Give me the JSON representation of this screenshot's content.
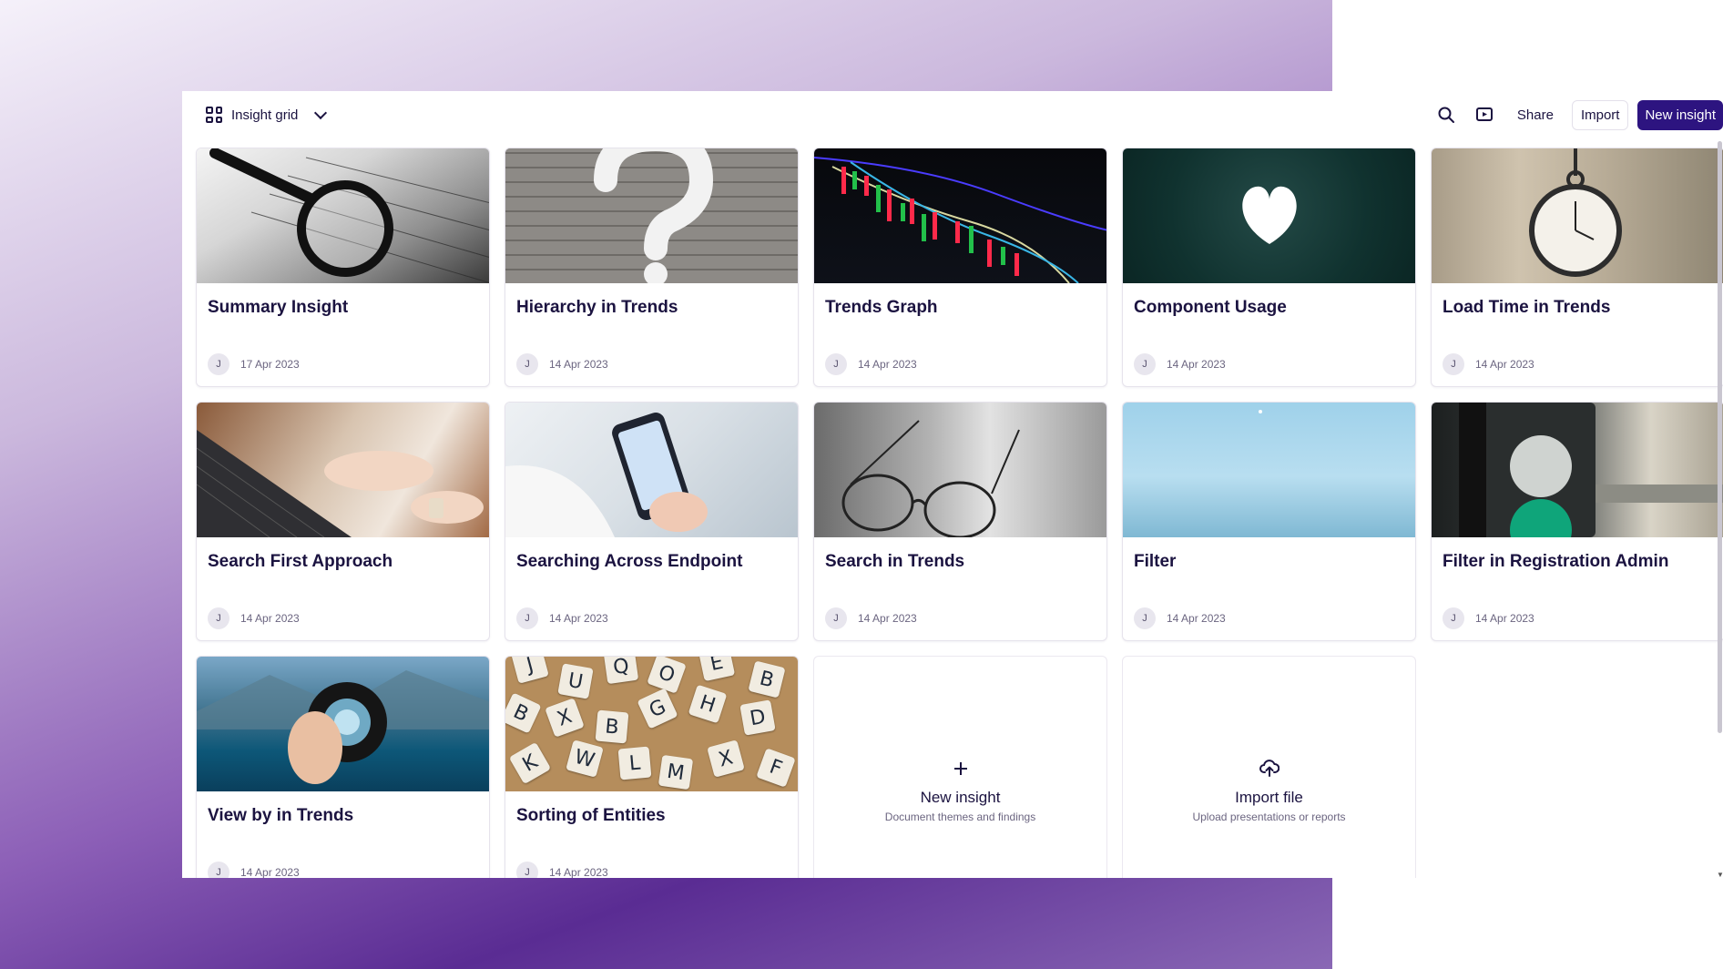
{
  "toolbar": {
    "view_label": "Insight grid",
    "share_label": "Share",
    "import_label": "Import",
    "new_insight_label": "New insight",
    "icons": {
      "view": "grid-icon",
      "dropdown": "chevron-down-icon",
      "search": "search-icon",
      "present": "present-icon"
    }
  },
  "cards": [
    {
      "title": "Summary Insight",
      "avatar": "J",
      "date": "17 Apr 2023",
      "image": "laptop-magnifier"
    },
    {
      "title": "Hierarchy in Trends",
      "avatar": "J",
      "date": "14 Apr 2023",
      "image": "question-mark-wall"
    },
    {
      "title": "Trends Graph",
      "avatar": "J",
      "date": "14 Apr 2023",
      "image": "trading-chart"
    },
    {
      "title": "Component Usage",
      "avatar": "J",
      "date": "14 Apr 2023",
      "image": "heart"
    },
    {
      "title": "Load Time in Trends",
      "avatar": "J",
      "date": "14 Apr 2023",
      "image": "pocket-watch"
    },
    {
      "title": "Search First Approach",
      "avatar": "J",
      "date": "14 Apr 2023",
      "image": "typing-laptop"
    },
    {
      "title": "Searching Across Endpoint",
      "avatar": "J",
      "date": "14 Apr 2023",
      "image": "phone-in-hand"
    },
    {
      "title": "Search in Trends",
      "avatar": "J",
      "date": "14 Apr 2023",
      "image": "glasses"
    },
    {
      "title": "Filter",
      "avatar": "J",
      "date": "14 Apr 2023",
      "image": "sky"
    },
    {
      "title": "Filter in Registration Admin",
      "avatar": "J",
      "date": "14 Apr 2023",
      "image": "traffic-light"
    },
    {
      "title": "View by in Trends",
      "avatar": "J",
      "date": "14 Apr 2023",
      "image": "lens"
    },
    {
      "title": "Sorting of Entities",
      "avatar": "J",
      "date": "14 Apr 2023",
      "image": "letter-tiles"
    }
  ],
  "new_card": {
    "title": "New insight",
    "subtitle": "Document themes and findings",
    "icon": "plus-icon"
  },
  "import_card": {
    "title": "Import file",
    "subtitle": "Upload presentations or reports",
    "icon": "upload-cloud-icon"
  },
  "colors": {
    "primary": "#2d1480",
    "text": "#1b1340",
    "muted": "#6b6580"
  }
}
